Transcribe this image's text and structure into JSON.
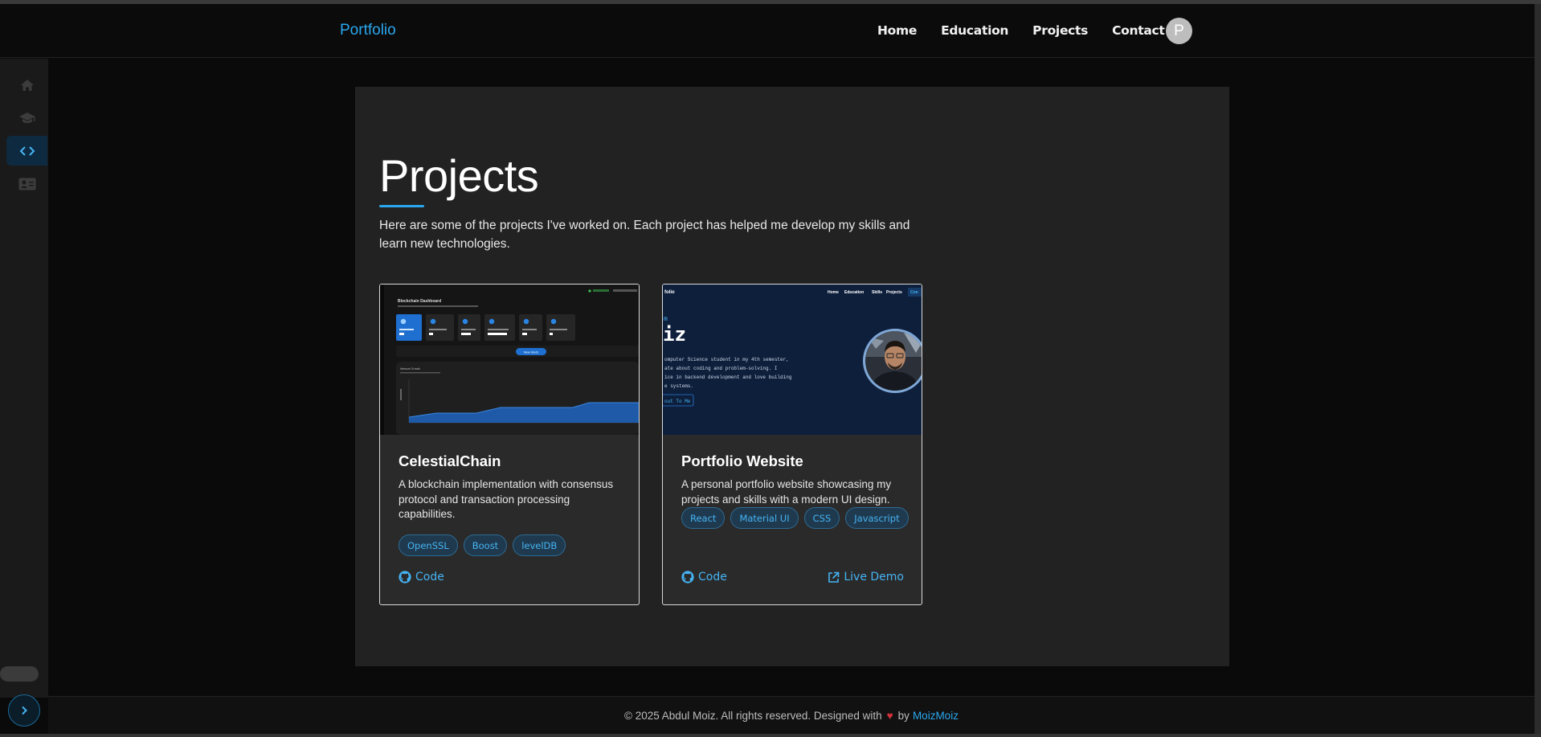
{
  "header": {
    "brand": "Portfolio",
    "nav": [
      "Home",
      "Education",
      "Projects",
      "Contact"
    ],
    "avatar_letter": "P"
  },
  "sidebar": {
    "items": [
      {
        "icon": "home-icon",
        "active": false
      },
      {
        "icon": "graduation-cap-icon",
        "active": false
      },
      {
        "icon": "code-icon",
        "active": true
      },
      {
        "icon": "contact-card-icon",
        "active": false
      }
    ],
    "toggle_icon": "chevron-right-icon"
  },
  "main": {
    "title": "Projects",
    "intro": "Here are some of the projects I've worked on. Each project has helped me develop my skills and learn new technologies.",
    "projects": [
      {
        "title": "CelestialChain",
        "description": "A blockchain implementation with consensus protocol and transaction processing capabilities.",
        "tags": [
          "OpenSSL",
          "Boost",
          "levelDB"
        ],
        "code_label": "Code",
        "thumbnail": {
          "app_title": "Blockchain Dashboard",
          "button": "New block",
          "chart_label": "Network Growth"
        }
      },
      {
        "title": "Portfolio Website",
        "description": "A personal portfolio website showcasing my projects and skills with a modern UI design.",
        "tags": [
          "React",
          "Material UI",
          "CSS",
          "Javascript"
        ],
        "code_label": "Code",
        "demo_label": "Live Demo",
        "thumbnail": {
          "nav": [
            "Home",
            "Education",
            "Skills",
            "Projects",
            "Con"
          ],
          "heading_frag": "iz",
          "pre_frag": "m",
          "lines": [
            "omputer Science student in my 4th semester,",
            "ate about coding and problem-solving. I",
            "ice in backend development and love building",
            "e systems."
          ],
          "button": "out To Me"
        }
      }
    ]
  },
  "footer": {
    "prefix": "© 2025 Abdul Moiz. All rights reserved. Designed with",
    "heart": "♥",
    "by": "by",
    "author": "MoizMoiz"
  },
  "colors": {
    "accent": "#2aa7ee",
    "panel": "#222222",
    "background": "#0a0a0a",
    "tag_bg": "#1f3a4f"
  }
}
